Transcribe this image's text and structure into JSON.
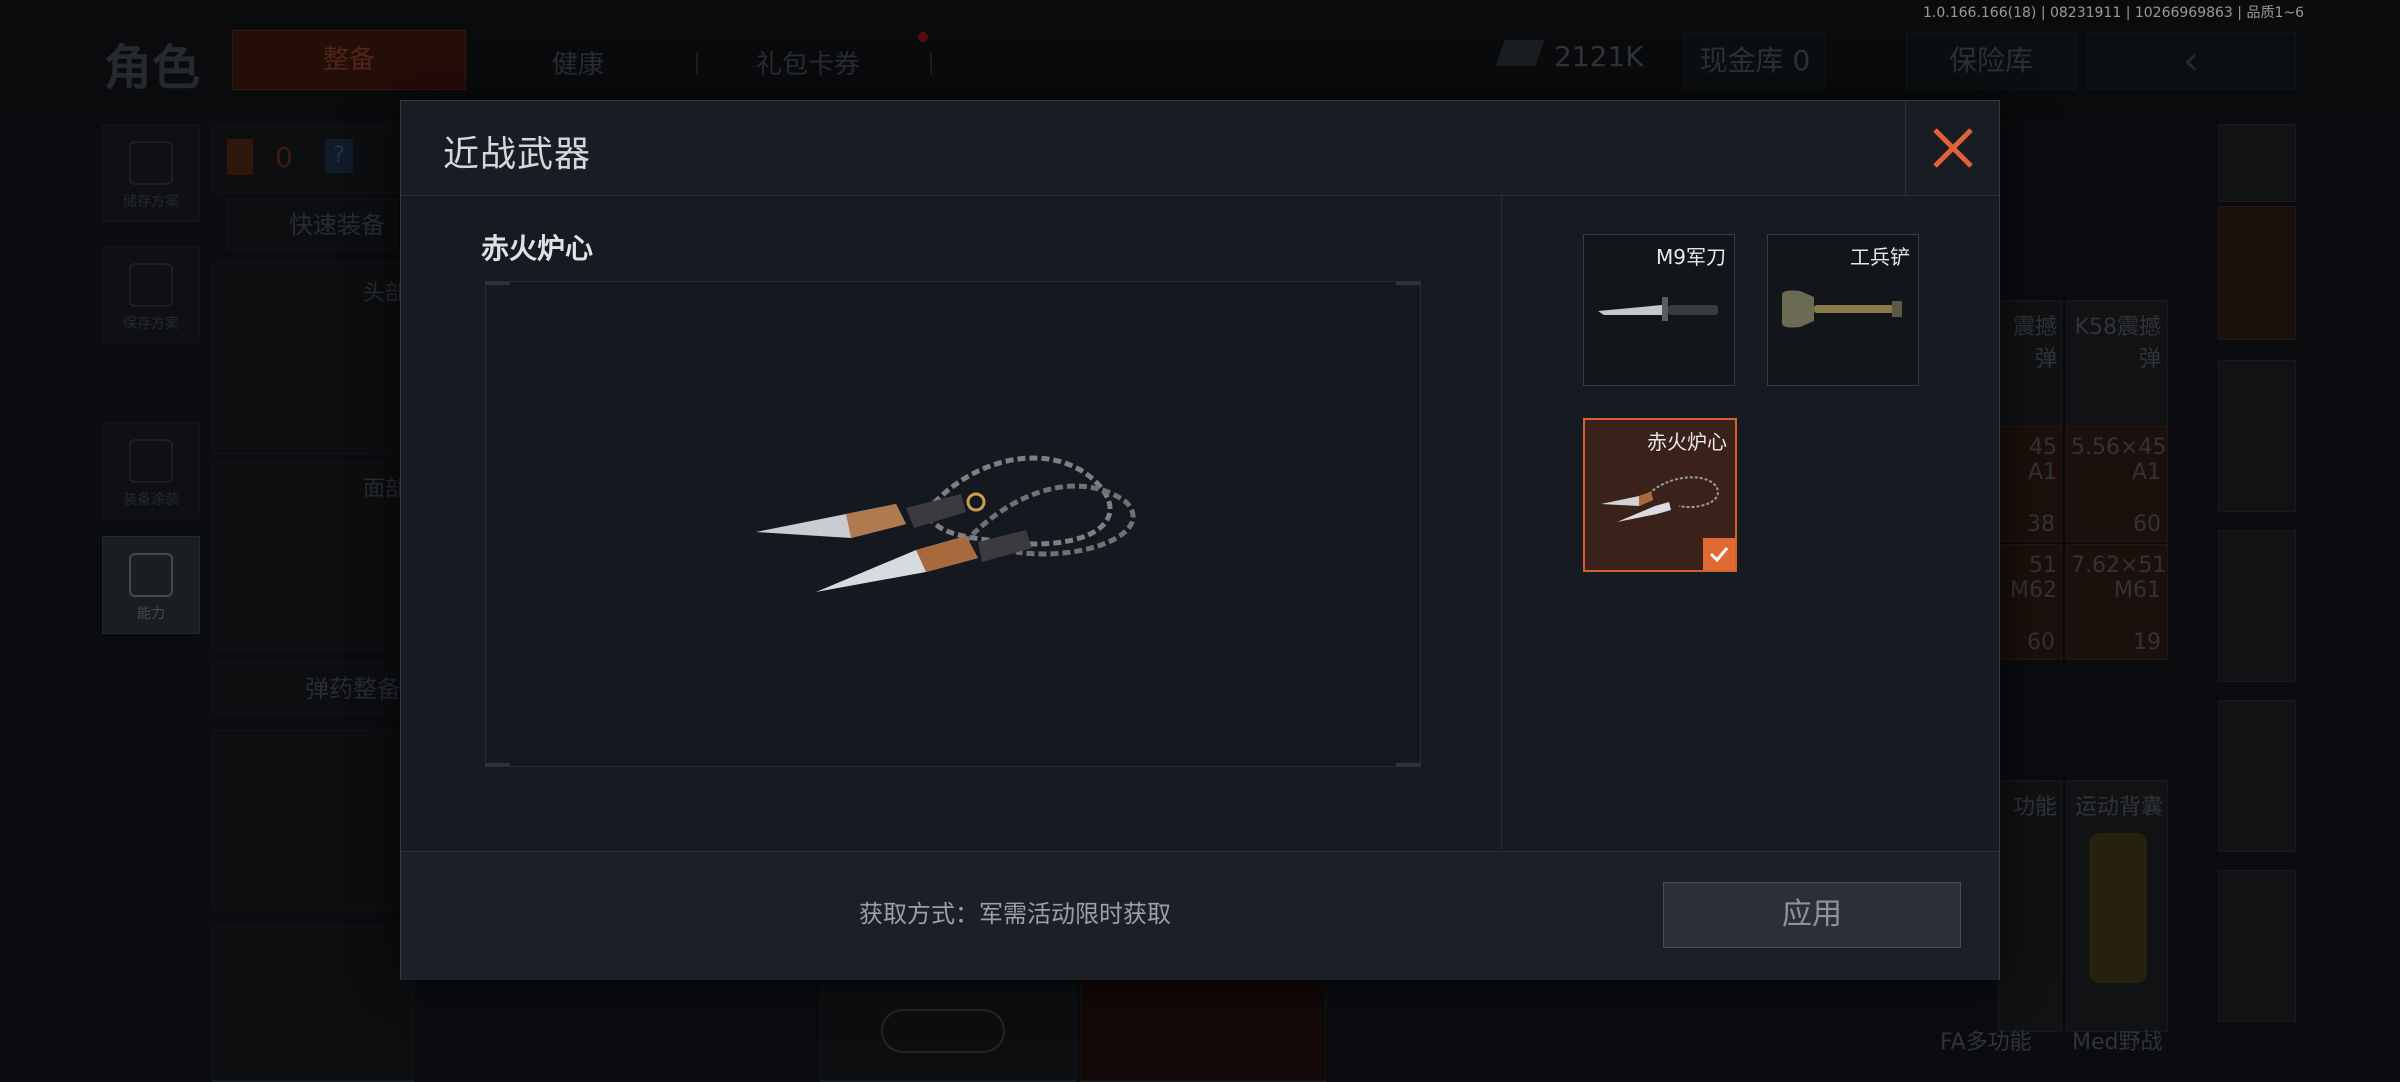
{
  "status": {
    "version": "1.0.166.166(18) | 08231911 | 10266969863 | 品质1~6"
  },
  "background": {
    "page_title": "角色",
    "tabs": [
      {
        "label": "整备"
      },
      {
        "label": "健康"
      },
      {
        "label": "礼包卡券"
      }
    ],
    "money": "2121K",
    "cash_vault": "现金库 0",
    "safe_box": "保险库",
    "left_rail": [
      {
        "label": "储存方案"
      },
      {
        "label": "保存方案"
      },
      {
        "label": "装备涂装"
      },
      {
        "label": "能力"
      }
    ],
    "counter": "0",
    "help": "?",
    "quick_equip": "快速装备",
    "head_label": "头部",
    "face_label": "面部",
    "ammo_equip": "弹药整备",
    "right_slots": [
      {
        "name": "震撼弹",
        "count": ""
      },
      {
        "name": "K58震撼弹",
        "count": ""
      },
      {
        "name": "45 A1",
        "count": "38"
      },
      {
        "name": "5.56×45 A1",
        "count": "60"
      },
      {
        "name": "51 M62",
        "count": "60"
      },
      {
        "name": "7.62×51 M61",
        "count": "19"
      },
      {
        "name": "功能",
        "count": ""
      },
      {
        "name": "运动背囊",
        "count": ""
      },
      {
        "name": "FA多功能",
        "count": ""
      },
      {
        "name": "Med野战",
        "count": ""
      }
    ]
  },
  "modal": {
    "title": "近战武器",
    "selected_item_name": "赤火炉心",
    "items": [
      {
        "label": "M9军刀",
        "selected": false,
        "icon": "knife-icon"
      },
      {
        "label": "工兵铲",
        "selected": false,
        "icon": "shovel-icon"
      },
      {
        "label": "赤火炉心",
        "selected": true,
        "icon": "chain-blade-icon"
      }
    ],
    "acquire_text": "获取方式：军需活动限时获取",
    "apply_label": "应用"
  },
  "colors": {
    "accent": "#e06a32",
    "close": "#e0623a"
  }
}
